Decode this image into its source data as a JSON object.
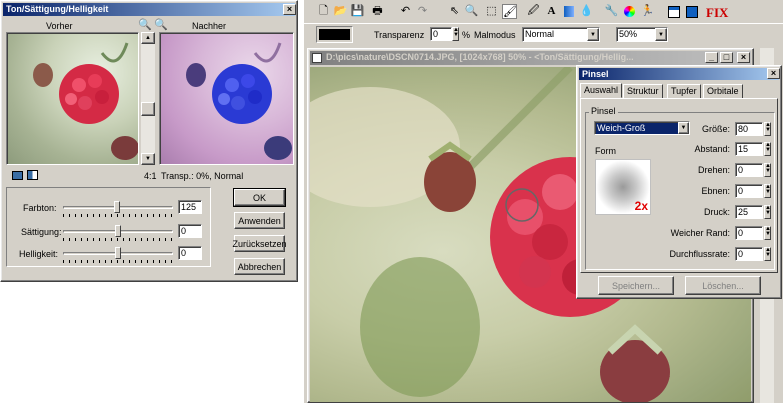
{
  "hsl_dialog": {
    "title": "Ton/Sättigung/Helligkeit",
    "before_label": "Vorher",
    "after_label": "Nachher",
    "zoom_ratio": "4:1",
    "transp_info": "Transp.: 0%, Normal",
    "sliders": [
      {
        "label": "Farbton:",
        "value": "125",
        "level": 0.49
      },
      {
        "label": "Sättigung:",
        "value": "0",
        "level": 0.5
      },
      {
        "label": "Helligkeit:",
        "value": "0",
        "level": 0.5
      }
    ],
    "buttons": {
      "ok": "OK",
      "apply": "Anwenden",
      "reset": "Zurücksetzen",
      "cancel": "Abbrechen"
    }
  },
  "toolbar": {
    "transparency_label": "Transparenz",
    "transparency_value": "0",
    "transparency_unit": "%",
    "blend_label": "Malmodus",
    "blend_value": "Normal",
    "zoom_value": "50%",
    "fix_label": "FIX"
  },
  "image_window": {
    "title": "D:\\pics\\nature\\DSCN0714.JPG, [1024x768] 50%  - <Ton/Sättigung/Hellig..."
  },
  "brush_panel": {
    "title": "Pinsel",
    "tabs": [
      "Auswahl",
      "Struktur",
      "Tupfer",
      "Orbitale"
    ],
    "group_label": "Pinsel",
    "brush_select": "Weich-Groß",
    "form_label": "Form",
    "form_scale": "2x",
    "params": [
      {
        "label": "Größe:",
        "value": "80"
      },
      {
        "label": "Abstand:",
        "value": "15"
      },
      {
        "label": "Drehen:",
        "value": "0"
      },
      {
        "label": "Ebnen:",
        "value": "0"
      },
      {
        "label": "Druck:",
        "value": "25"
      },
      {
        "label": "Weicher Rand:",
        "value": "0"
      },
      {
        "label": "Durchflussrate:",
        "value": "0"
      }
    ],
    "save_button": "Speichern...",
    "delete_button": "Löschen..."
  },
  "colors": {
    "accent_title": "#0a246a",
    "fix_red": "#cc0000"
  }
}
